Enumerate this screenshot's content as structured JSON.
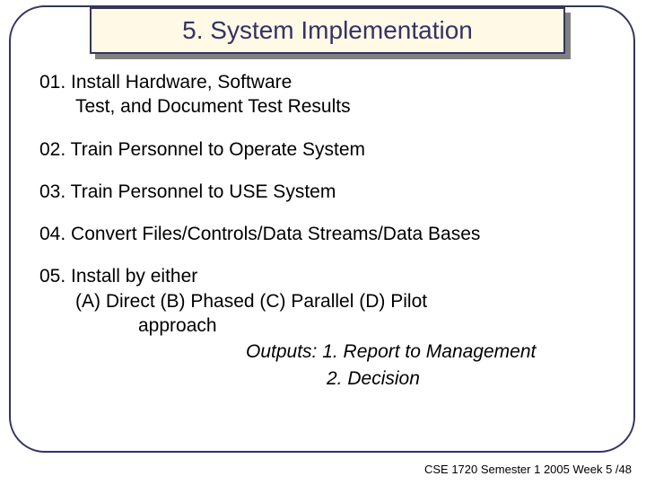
{
  "title": "5.  System Implementation",
  "items": {
    "i1_line1": "01. Install Hardware, Software",
    "i1_line2": "Test, and Document Test Results",
    "i2": "02. Train Personnel to Operate System",
    "i3": "03.  Train Personnel to USE System",
    "i4": "04.  Convert Files/Controls/Data Streams/Data Bases",
    "i5_line1": "05.  Install by either",
    "i5_line2": "(A)  Direct   (B) Phased  (C) Parallel  (D) Pilot",
    "i5_line3": "approach"
  },
  "outputs": {
    "line1": "Outputs: 1. Report to Management",
    "line2": "2. Decision"
  },
  "footer": "CSE 1720  Semester 1 2005  Week 5 /48"
}
